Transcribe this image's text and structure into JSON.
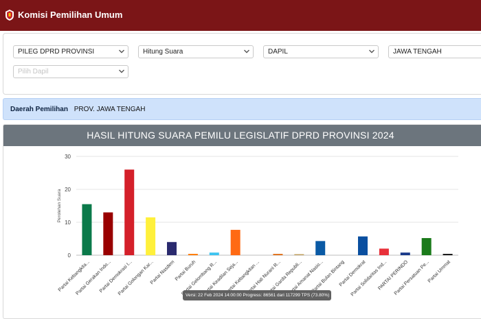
{
  "app": {
    "title": "Komisi Pemilihan Umum"
  },
  "filters": {
    "election_type": "PILEG DPRD PROVINSI",
    "count_mode": "Hitung Suara",
    "area_level": "DAPIL",
    "province": "JAWA TENGAH",
    "dapil_placeholder": "Pilih Dapil"
  },
  "region": {
    "label": "Daerah Pemilihan",
    "value": "PROV. JAWA TENGAH"
  },
  "chart_data": {
    "type": "bar",
    "title": "HASIL HITUNG SUARA PEMILU LEGISLATIF DPRD PROVINSI 2024",
    "ylabel": "Perolehan Suara",
    "ylim": [
      0,
      30
    ],
    "yticks": [
      0,
      10,
      20,
      30
    ],
    "grid": true,
    "categories": [
      "Partai Kebangkita...",
      "Partai Gerakan Indo...",
      "Partai Demokrasi I...",
      "Partai Golongan Kar...",
      "Partai Nasdem",
      "Partai Buruh",
      "Partai Gelombang R...",
      "Partai Keadilan Seja...",
      "Partai Kebangkitan ...",
      "Partai Hati Nurani R...",
      "Partai Garda Republi...",
      "Partai Amanat Nasio...",
      "Partai Bulan Bintang",
      "Partai Demokrat",
      "Partai Solidaritas Ind...",
      "PARTAI PERINDO",
      "Partai Persatuan Pe...",
      "Partai Ummat"
    ],
    "values": [
      15.5,
      13,
      26,
      11.5,
      4,
      0.4,
      0.8,
      7.7,
      0,
      0.4,
      0.2,
      4.3,
      0,
      5.7,
      2,
      0.8,
      5.2,
      0.4
    ],
    "colors": [
      "#0b7a4a",
      "#990000",
      "#d4202a",
      "#fff03b",
      "#2a2a6e",
      "#ff7a00",
      "#3ec4f0",
      "#ff6a13",
      "#0b8a3a",
      "#e0701a",
      "#c0a060",
      "#0a5aa5",
      "#2c8a3a",
      "#0a4fa0",
      "#e8303a",
      "#1a3a8a",
      "#1a7a1a",
      "#111111"
    ]
  },
  "status": {
    "tooltip": "Versi: 22 Feb 2024 14:00:00 Progress: 86561 dari 117299 TPS (73.80%)"
  }
}
